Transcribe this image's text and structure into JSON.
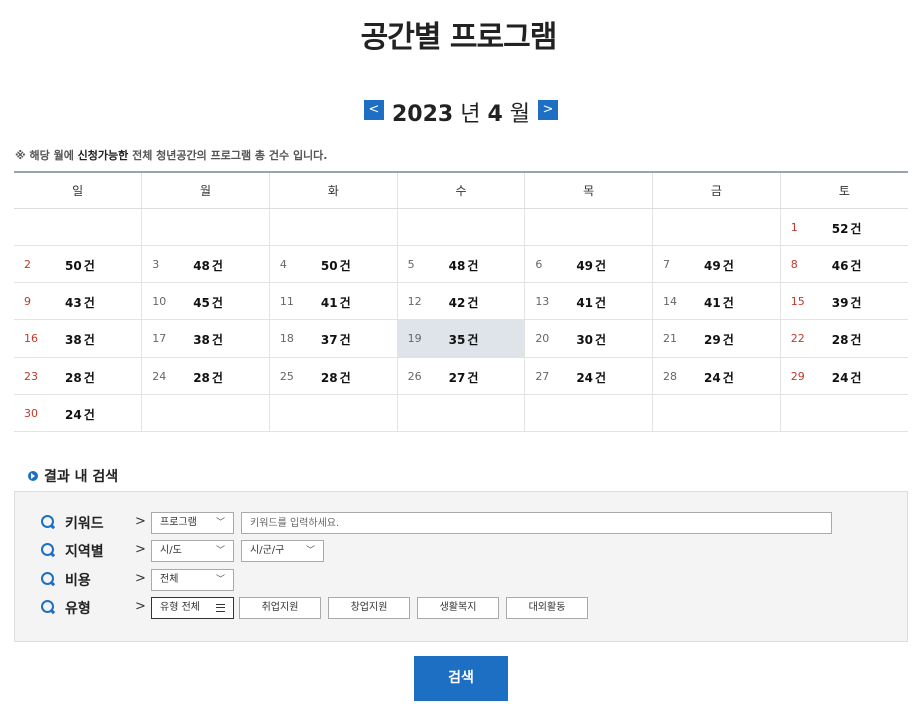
{
  "page_title": "공간별 프로그램",
  "month_nav": {
    "prev_label": "<",
    "next_label": ">",
    "year": "2023",
    "year_unit": "년",
    "month": "4",
    "month_unit": "월"
  },
  "note": {
    "prefix": "※ 해당 월에 ",
    "highlight": "신청가능한",
    "suffix": " 전체 청년공간의 프로그램 총 건수 입니다."
  },
  "calendar": {
    "weekdays": [
      "일",
      "월",
      "화",
      "수",
      "목",
      "금",
      "토"
    ],
    "count_unit": "건",
    "today": "19",
    "weeks": [
      [
        null,
        null,
        null,
        null,
        null,
        null,
        {
          "day": "1",
          "count": "52"
        }
      ],
      [
        {
          "day": "2",
          "count": "50"
        },
        {
          "day": "3",
          "count": "48"
        },
        {
          "day": "4",
          "count": "50"
        },
        {
          "day": "5",
          "count": "48"
        },
        {
          "day": "6",
          "count": "49"
        },
        {
          "day": "7",
          "count": "49"
        },
        {
          "day": "8",
          "count": "46"
        }
      ],
      [
        {
          "day": "9",
          "count": "43"
        },
        {
          "day": "10",
          "count": "45"
        },
        {
          "day": "11",
          "count": "41"
        },
        {
          "day": "12",
          "count": "42"
        },
        {
          "day": "13",
          "count": "41"
        },
        {
          "day": "14",
          "count": "41"
        },
        {
          "day": "15",
          "count": "39"
        }
      ],
      [
        {
          "day": "16",
          "count": "38"
        },
        {
          "day": "17",
          "count": "38"
        },
        {
          "day": "18",
          "count": "37"
        },
        {
          "day": "19",
          "count": "35"
        },
        {
          "day": "20",
          "count": "30"
        },
        {
          "day": "21",
          "count": "29"
        },
        {
          "day": "22",
          "count": "28"
        }
      ],
      [
        {
          "day": "23",
          "count": "28"
        },
        {
          "day": "24",
          "count": "28"
        },
        {
          "day": "25",
          "count": "28"
        },
        {
          "day": "26",
          "count": "27"
        },
        {
          "day": "27",
          "count": "24"
        },
        {
          "day": "28",
          "count": "24"
        },
        {
          "day": "29",
          "count": "24"
        }
      ],
      [
        {
          "day": "30",
          "count": "24"
        },
        null,
        null,
        null,
        null,
        null,
        null
      ]
    ]
  },
  "search_section": {
    "title": "결과 내 검색",
    "arrow": ">",
    "keyword": {
      "label": "키워드",
      "select_value": "프로그램",
      "input_placeholder": "키워드를 입력하세요."
    },
    "region": {
      "label": "지역별",
      "city_value": "시/도",
      "district_value": "시/군/구"
    },
    "cost": {
      "label": "비용",
      "select_value": "전체"
    },
    "type": {
      "label": "유형",
      "all_label": "유형 전체",
      "buttons": [
        "취업지원",
        "창업지원",
        "생활복지",
        "대외활동"
      ]
    },
    "chevron": "﹀"
  },
  "search_button_label": "검색"
}
